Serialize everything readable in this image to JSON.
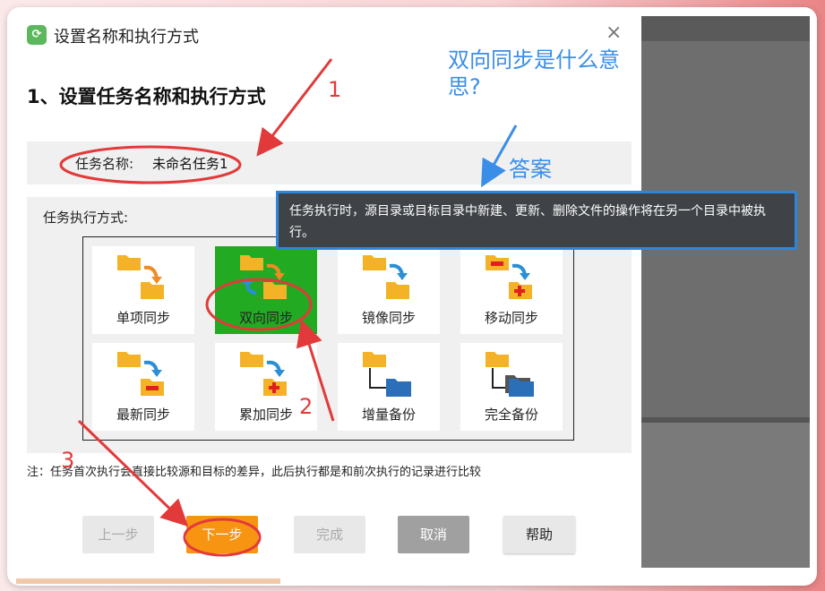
{
  "dialog": {
    "title": "设置名称和执行方式",
    "heading": "1、设置任务名称和执行方式",
    "close_icon": "close-icon"
  },
  "task_name": {
    "label": "任务名称:",
    "value": "未命名任务1"
  },
  "mode": {
    "label": "任务执行方式:",
    "tiles": [
      {
        "label": "单项同步",
        "icon": "folder-to-folder-icon",
        "selected": false
      },
      {
        "label": "双向同步",
        "icon": "two-way-sync-icon",
        "selected": true
      },
      {
        "label": "镜像同步",
        "icon": "mirror-folder-icon",
        "selected": false
      },
      {
        "label": "移动同步",
        "icon": "move-folder-icon",
        "selected": false
      },
      {
        "label": "最新同步",
        "icon": "newest-sync-icon",
        "selected": false
      },
      {
        "label": "累加同步",
        "icon": "accumulate-sync-icon",
        "selected": false
      },
      {
        "label": "增量备份",
        "icon": "incremental-backup-icon",
        "selected": false
      },
      {
        "label": "完全备份",
        "icon": "full-backup-icon",
        "selected": false
      }
    ]
  },
  "note": "注：任务首次执行会直接比较源和目标的差异，此后执行都是和前次执行的记录进行比较",
  "buttons": {
    "prev": "上一步",
    "next": "下一步",
    "done": "完成",
    "cancel": "取消",
    "help": "帮助"
  },
  "tooltip": "任务执行时，源目录或目标目录中新建、更新、删除文件的操作将在另一个目录中被执行。",
  "annotations": {
    "question": "双向同步是什么意思?",
    "answer": "答案",
    "n1": "1",
    "n2": "2",
    "n3": "3"
  },
  "colors": {
    "selected_tile": "#22aa22",
    "next_button": "#f79412",
    "annotation_red": "#e23a3a",
    "annotation_blue": "#3a8ee8",
    "tooltip_border": "#2f86d8"
  }
}
